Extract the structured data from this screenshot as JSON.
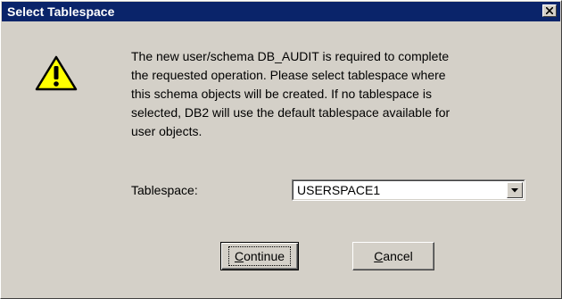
{
  "window": {
    "title": "Select Tablespace",
    "close_glyph": "✕"
  },
  "message": {
    "lines": [
      "The new user/schema DB_AUDIT is required to complete",
      "the requested operation.  Please select tablespace where",
      "this schema objects will be created.  If no tablespace is",
      "selected, DB2 will use the default tablespace available for",
      "user objects."
    ]
  },
  "form": {
    "tablespace_label": "Tablespace:",
    "tablespace_value": "USERSPACE1"
  },
  "buttons": {
    "continue_mnemonic": "C",
    "continue_rest": "ontinue",
    "cancel_mnemonic": "C",
    "cancel_rest": "ancel"
  },
  "icons": {
    "warning": "warning-icon",
    "close": "close-icon",
    "dropdown": "chevron-down-icon"
  },
  "colors": {
    "titlebar": "#0a246a",
    "dialog_bg": "#d4d0c8",
    "warning_fill": "#ffff00"
  }
}
